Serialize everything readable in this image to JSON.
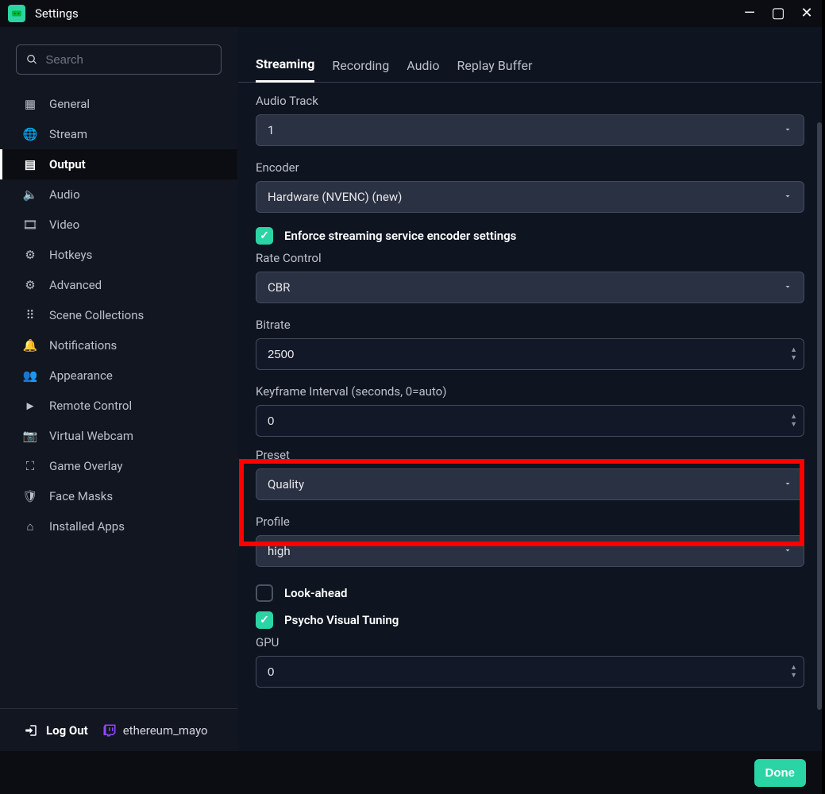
{
  "window": {
    "title": "Settings"
  },
  "search": {
    "placeholder": "Search"
  },
  "sidebar": {
    "items": [
      {
        "label": "General",
        "icon": "grid-icon"
      },
      {
        "label": "Stream",
        "icon": "globe-icon"
      },
      {
        "label": "Output",
        "icon": "chip-icon",
        "active": true
      },
      {
        "label": "Audio",
        "icon": "volume-icon"
      },
      {
        "label": "Video",
        "icon": "film-icon"
      },
      {
        "label": "Hotkeys",
        "icon": "gear-icon"
      },
      {
        "label": "Advanced",
        "icon": "gears-icon"
      },
      {
        "label": "Scene Collections",
        "icon": "dots-icon"
      },
      {
        "label": "Notifications",
        "icon": "bell-icon"
      },
      {
        "label": "Appearance",
        "icon": "people-icon"
      },
      {
        "label": "Remote Control",
        "icon": "play-circle-icon"
      },
      {
        "label": "Virtual Webcam",
        "icon": "camera-icon"
      },
      {
        "label": "Game Overlay",
        "icon": "expand-icon"
      },
      {
        "label": "Face Masks",
        "icon": "shield-icon"
      },
      {
        "label": "Installed Apps",
        "icon": "store-icon"
      }
    ],
    "logout_label": "Log Out",
    "username": "ethereum_mayo"
  },
  "tabs": [
    {
      "label": "Streaming",
      "active": true
    },
    {
      "label": "Recording"
    },
    {
      "label": "Audio"
    },
    {
      "label": "Replay Buffer"
    }
  ],
  "form": {
    "audio_track": {
      "label": "Audio Track",
      "value": "1"
    },
    "encoder": {
      "label": "Encoder",
      "value": "Hardware (NVENC) (new)"
    },
    "enforce": {
      "label": "Enforce streaming service encoder settings",
      "checked": true
    },
    "rate_control": {
      "label": "Rate Control",
      "value": "CBR"
    },
    "bitrate": {
      "label": "Bitrate",
      "value": "2500"
    },
    "keyframe": {
      "label": "Keyframe Interval (seconds, 0=auto)",
      "value": "0"
    },
    "preset": {
      "label": "Preset",
      "value": "Quality"
    },
    "profile": {
      "label": "Profile",
      "value": "high"
    },
    "lookahead": {
      "label": "Look-ahead",
      "checked": false
    },
    "psycho": {
      "label": "Psycho Visual Tuning",
      "checked": true
    },
    "gpu": {
      "label": "GPU",
      "value": "0"
    }
  },
  "footer": {
    "done_label": "Done"
  },
  "accent": "#2bd4a4"
}
